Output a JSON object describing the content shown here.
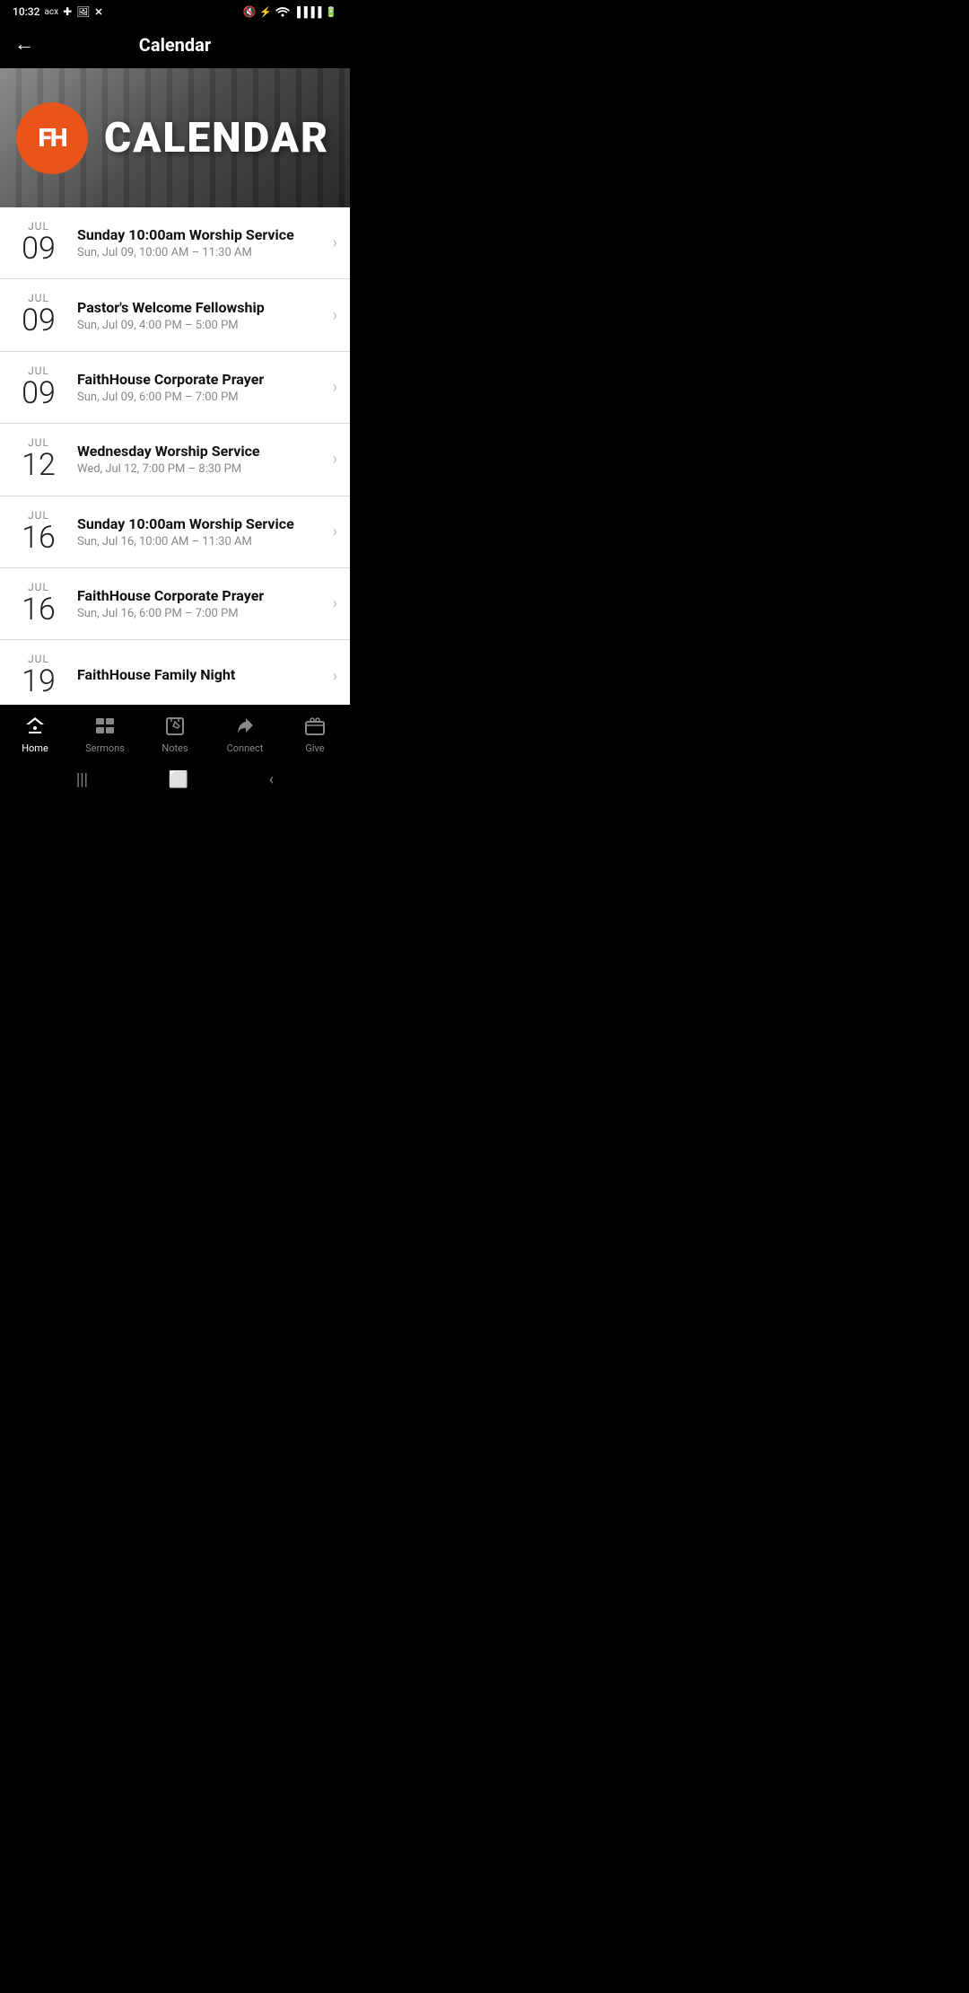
{
  "statusBar": {
    "time": "10:32",
    "leftIcons": [
      "acx",
      "+",
      "image",
      "x"
    ],
    "rightIcons": [
      "mute",
      "battery-charge",
      "wifi",
      "signal",
      "battery"
    ]
  },
  "header": {
    "backLabel": "←",
    "title": "Calendar"
  },
  "banner": {
    "logoText": "FH",
    "bannerTitle": "CALENDAR"
  },
  "events": [
    {
      "month": "JUL",
      "day": "09",
      "name": "Sunday 10:00am Worship Service",
      "time": "Sun, Jul 09, 10:00 AM – 11:30 AM"
    },
    {
      "month": "JUL",
      "day": "09",
      "name": "Pastor's Welcome Fellowship",
      "time": "Sun, Jul 09, 4:00 PM – 5:00 PM"
    },
    {
      "month": "JUL",
      "day": "09",
      "name": "FaithHouse Corporate Prayer",
      "time": "Sun, Jul 09, 6:00 PM – 7:00 PM"
    },
    {
      "month": "JUL",
      "day": "12",
      "name": "Wednesday Worship Service",
      "time": "Wed, Jul 12, 7:00 PM – 8:30 PM"
    },
    {
      "month": "JUL",
      "day": "16",
      "name": "Sunday 10:00am Worship Service",
      "time": "Sun, Jul 16, 10:00 AM – 11:30 AM"
    },
    {
      "month": "JUL",
      "day": "16",
      "name": "FaithHouse Corporate Prayer",
      "time": "Sun, Jul 16, 6:00 PM – 7:00 PM"
    },
    {
      "month": "JUL",
      "day": "19",
      "name": "FaithHouse Family Night",
      "time": ""
    }
  ],
  "bottomNav": {
    "items": [
      {
        "id": "home",
        "label": "Home",
        "active": true
      },
      {
        "id": "sermons",
        "label": "Sermons",
        "active": false
      },
      {
        "id": "notes",
        "label": "Notes",
        "active": false
      },
      {
        "id": "connect",
        "label": "Connect",
        "active": false
      },
      {
        "id": "give",
        "label": "Give",
        "active": false
      }
    ]
  }
}
